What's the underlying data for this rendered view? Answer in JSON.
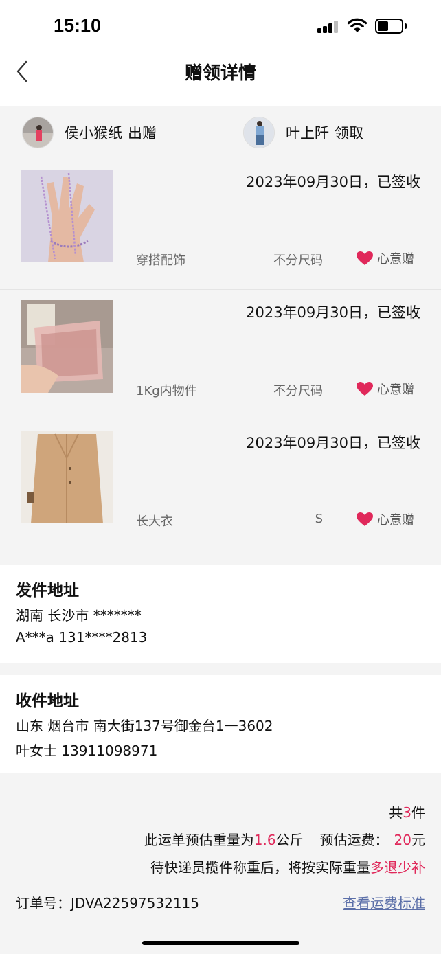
{
  "status_bar": {
    "time": "15:10"
  },
  "nav": {
    "title": "赠领详情"
  },
  "people": {
    "giver": {
      "name": "侯小猴纸",
      "action": "出赠"
    },
    "taker": {
      "name": "叶上阡",
      "action": "领取"
    }
  },
  "items": [
    {
      "date_status": "2023年09月30日，已签收",
      "category": "穿搭配饰",
      "size": "不分尺码",
      "tag": "心意赠",
      "thumb_color": "#d9d4e3"
    },
    {
      "date_status": "2023年09月30日，已签收",
      "category": "1Kg内物件",
      "size": "不分尺码",
      "tag": "心意赠",
      "thumb_color": "#b9aaa2"
    },
    {
      "date_status": "2023年09月30日，已签收",
      "category": "长大衣",
      "size": "S",
      "tag": "心意赠",
      "thumb_color": "#cfa57b"
    }
  ],
  "sender": {
    "title": "发件地址",
    "line1": "湖南 长沙市 *******",
    "line2": "A***a 131****2813"
  },
  "receiver": {
    "title": "收件地址",
    "line1": "山东 烟台市 南大街137号御金台1一3602",
    "line2": "叶女士 13911098971"
  },
  "summary": {
    "count_prefix": "共",
    "count": "3",
    "count_suffix": "件",
    "weight_prefix": "此运单预估重量为",
    "weight": "1.6",
    "weight_unit": "公斤",
    "fee_label": "预估运费：",
    "fee": "20",
    "fee_unit": "元",
    "note_prefix": "待快递员揽件称重后，将按实际重量",
    "note_accent": "多退少补",
    "order_label": "订单号：",
    "order_no": "JDVA22597532115",
    "fee_link": "查看运费标准"
  },
  "colors": {
    "accent": "#e0285a",
    "link": "#5a6ea8",
    "heart": "#e0285a"
  }
}
